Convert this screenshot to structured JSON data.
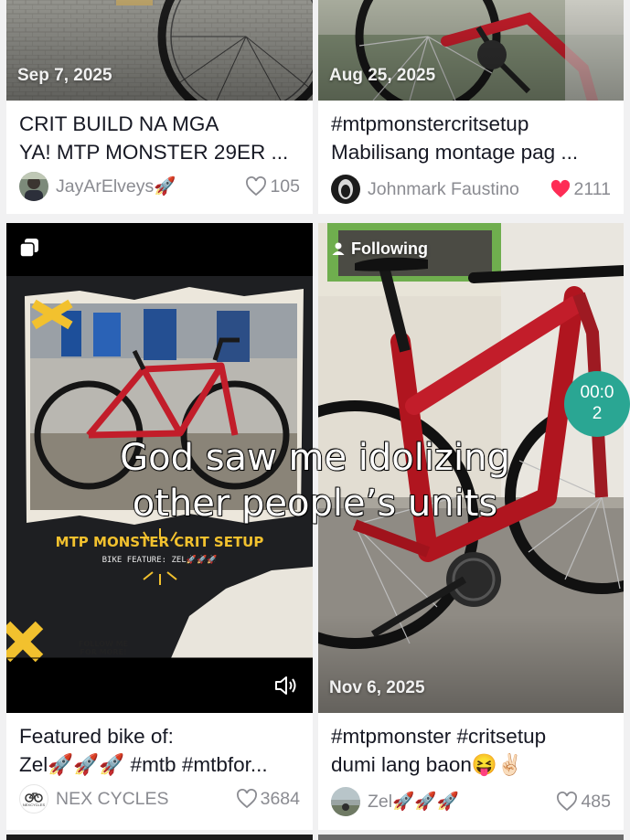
{
  "feed": {
    "cards": [
      {
        "date": "Sep 7, 2025",
        "title_line1": "CRIT BUILD NA MGA",
        "title_line2": "YA! MTP MONSTER 29ER ...",
        "author": "JayArElveys🚀",
        "likes": "105",
        "liked": false
      },
      {
        "date": "Aug 25, 2025",
        "title_line1": "#mtpmonstercritsetup",
        "title_line2": "Mabilisang montage pag ...",
        "author": "Johnmark Faustino",
        "likes": "2111",
        "liked": true
      },
      {
        "badge": "",
        "thumb_heading": "MTP MONSTER CRIT SETUP",
        "thumb_sub": "BIKE FEATURE: ZEL🚀🚀🚀",
        "thumb_follow": "FOLLOW ME\nFOR MORE!",
        "title_line1": "Featured bike of:",
        "title_line2": "Zel🚀🚀🚀 #mtb #mtbfor...",
        "author": "NEX CYCLES",
        "avatar_text": "NEXCYCLES",
        "likes": "3684",
        "liked": false
      },
      {
        "following_label": "Following",
        "date": "Nov 6, 2025",
        "title_line1": "#mtpmonster #critsetup",
        "title_line2": "dumi lang baon😝✌🏻",
        "author": "Zel🚀🚀🚀",
        "likes": "485",
        "liked": false
      }
    ]
  },
  "overlay": {
    "caption_line1": "God saw me idolizing",
    "caption_line2": "other people’s units",
    "timer_line1": "00:0",
    "timer_line2": "2"
  },
  "colors": {
    "background": "#f1f1f2",
    "text": "#161823",
    "muted": "#8a8b91",
    "like_red": "#fe2c55",
    "timer": "#2aa693",
    "bike_red": "#c21d2a"
  },
  "icons": [
    "heart-outline-icon",
    "heart-filled-icon",
    "user-icon",
    "multi-photo-icon",
    "volume-icon"
  ]
}
